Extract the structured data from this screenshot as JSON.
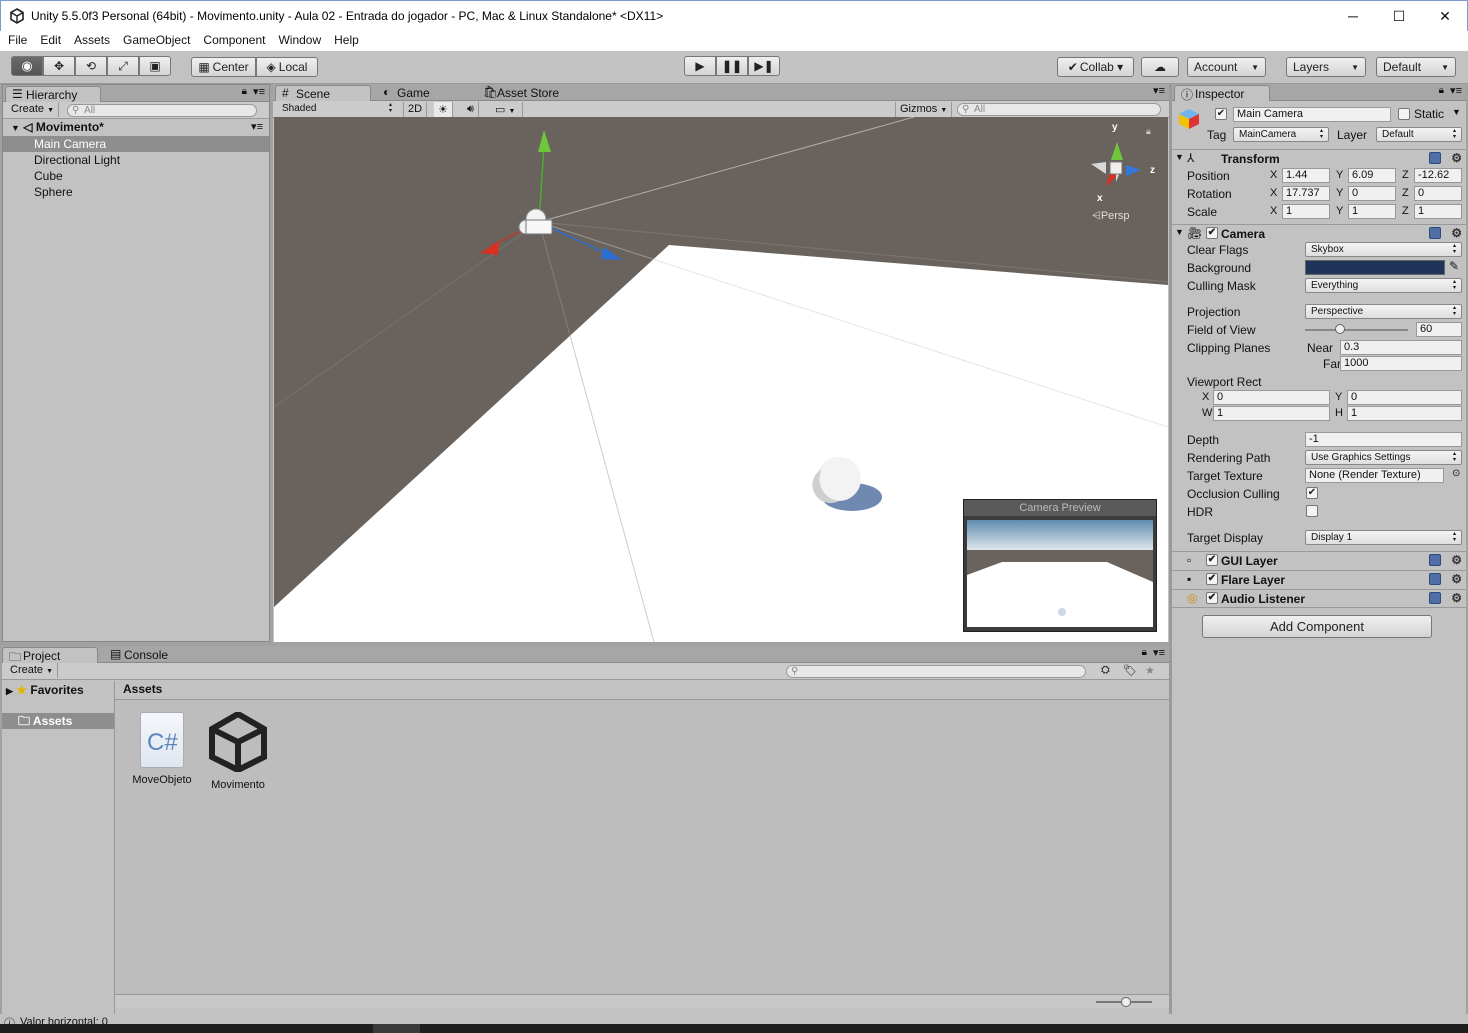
{
  "window": {
    "title": "Unity 5.5.0f3 Personal (64bit) - Movimento.unity - Aula 02 - Entrada do jogador - PC, Mac & Linux Standalone* <DX11>",
    "minimize": "─",
    "maximize": "☐",
    "close": "✕"
  },
  "menu": [
    "File",
    "Edit",
    "Assets",
    "GameObject",
    "Component",
    "Window",
    "Help"
  ],
  "toolbar": {
    "pivot": "Center",
    "space": "Local",
    "collab": "Collab ▾",
    "account": "Account",
    "layers": "Layers",
    "layout": "Default"
  },
  "hierarchy": {
    "tab": "Hierarchy",
    "create": "Create",
    "search_placeholder": "All",
    "scene_name": "Movimento*",
    "items": [
      "Main Camera",
      "Directional Light",
      "Cube",
      "Sphere"
    ]
  },
  "scene": {
    "tabs": [
      "Scene",
      "Game",
      "Asset Store"
    ],
    "shading": "Shaded",
    "mode_2d": "2D",
    "gizmos": "Gizmos",
    "search_placeholder": "All",
    "persp_label": "Persp",
    "gizmo_axes": {
      "y": "y",
      "x": "x",
      "z": "z"
    },
    "camera_preview_title": "Camera Preview"
  },
  "project": {
    "tabs": [
      "Project",
      "Console"
    ],
    "create": "Create",
    "favorites": "Favorites",
    "assets_folder": "Assets",
    "breadcrumb": "Assets",
    "files": [
      {
        "name": "MoveObjeto",
        "icon": "csharp-script-icon"
      },
      {
        "name": "Movimento",
        "icon": "unity-scene-icon"
      }
    ]
  },
  "status": {
    "text": "Valor horizontal: 0"
  },
  "inspector": {
    "tab": "Inspector",
    "object_name": "Main Camera",
    "static_label": "Static",
    "tag_label": "Tag",
    "tag_value": "MainCamera",
    "layer_label": "Layer",
    "layer_value": "Default",
    "transform": {
      "title": "Transform",
      "position_label": "Position",
      "rotation_label": "Rotation",
      "scale_label": "Scale",
      "position": {
        "x": "1.44",
        "y": "6.09",
        "z": "-12.62"
      },
      "rotation": {
        "x": "17.737",
        "y": "0",
        "z": "0"
      },
      "scale": {
        "x": "1",
        "y": "1",
        "z": "1"
      }
    },
    "camera": {
      "title": "Camera",
      "clear_flags_label": "Clear Flags",
      "clear_flags": "Skybox",
      "background_label": "Background",
      "background_color": "#1e3559",
      "culling_mask_label": "Culling Mask",
      "culling_mask": "Everything",
      "projection_label": "Projection",
      "projection": "Perspective",
      "fov_label": "Field of View",
      "fov": "60",
      "clipping_label": "Clipping Planes",
      "near_label": "Near",
      "near": "0.3",
      "far_label": "Far",
      "far": "1000",
      "viewport_label": "Viewport Rect",
      "viewport": {
        "x": "0",
        "y": "0",
        "w": "1",
        "h": "1"
      },
      "depth_label": "Depth",
      "depth": "-1",
      "rendering_path_label": "Rendering Path",
      "rendering_path": "Use Graphics Settings",
      "target_texture_label": "Target Texture",
      "target_texture": "None (Render Texture)",
      "occlusion_label": "Occlusion Culling",
      "occlusion": true,
      "hdr_label": "HDR",
      "hdr": false,
      "target_display_label": "Target Display",
      "target_display": "Display 1"
    },
    "components": [
      "GUI Layer",
      "Flare Layer",
      "Audio Listener"
    ],
    "add_component": "Add Component"
  },
  "axis_labels": {
    "x": "X",
    "y": "Y",
    "z": "Z",
    "w": "W",
    "h": "H"
  }
}
